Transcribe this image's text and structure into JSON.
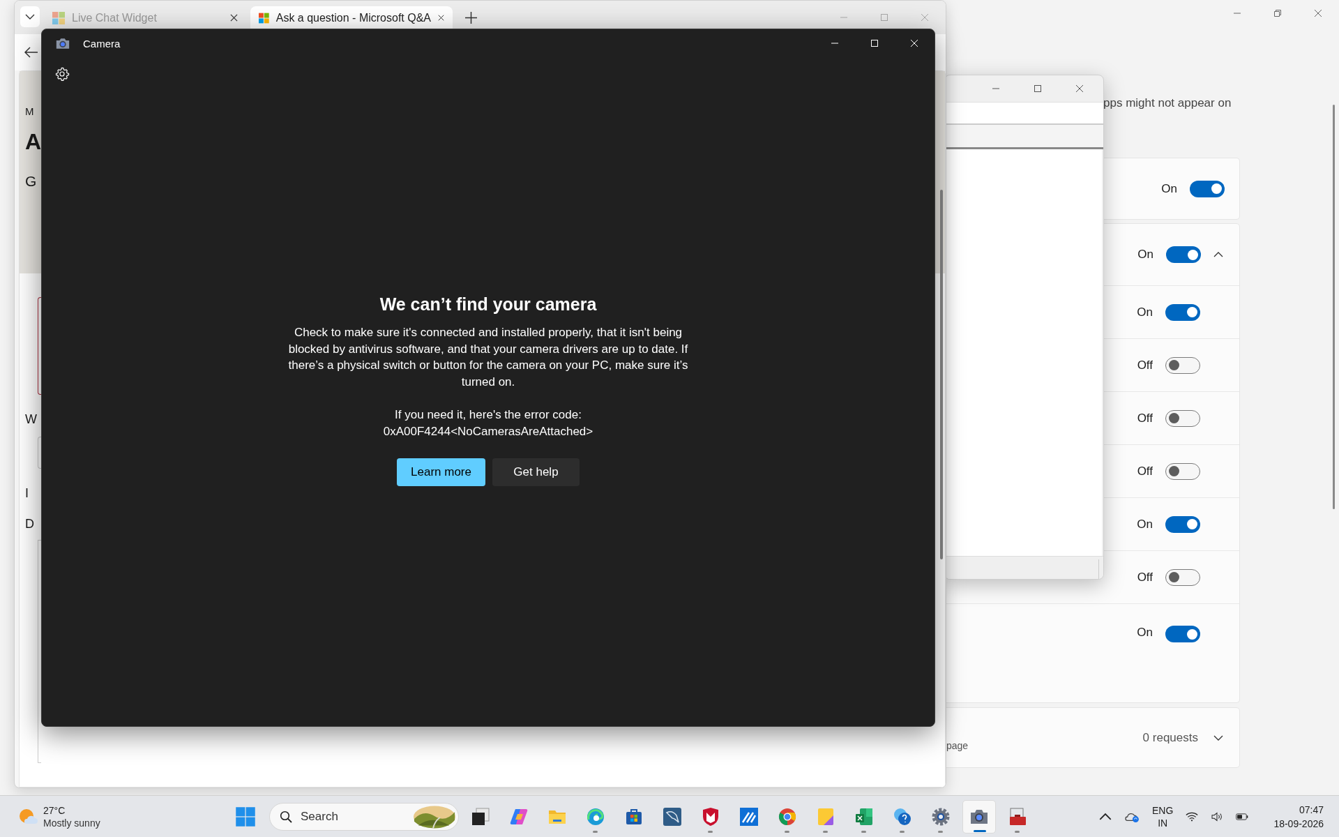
{
  "browser": {
    "tabs": [
      {
        "title": "Live Chat Widget",
        "selected": false
      },
      {
        "title": "Ask a question - Microsoft Q&A",
        "selected": true
      }
    ],
    "page_fragments": [
      {
        "text": "M",
        "kind": "small"
      },
      {
        "text": "A",
        "kind": "title"
      },
      {
        "text": "G",
        "kind": "lead"
      },
      {
        "text": "W",
        "kind": "label"
      },
      {
        "text": "I",
        "kind": "label"
      },
      {
        "text": "D",
        "kind": "label"
      }
    ]
  },
  "camera_window": {
    "title": "Camera",
    "heading": "We can’t find your camera",
    "message": "Check to make sure it's connected and installed properly, that it isn't being blocked by antivirus software, and that your camera drivers are up to date. If there’s a physical switch or button for the camera on your PC, make sure it’s turned on.",
    "error_intro": "If you need it, here's the error code:",
    "error_code": "0xA00F4244<NoCamerasAreAttached>",
    "buttons": [
      {
        "label": "Learn more",
        "kind": "primary"
      },
      {
        "label": "Get help",
        "kind": "secondary"
      }
    ]
  },
  "settings": {
    "description": "pps might not appear on",
    "toggles": [
      {
        "label": "On",
        "on": true,
        "kind": "card"
      },
      {
        "label": "On",
        "on": true,
        "kind": "expander"
      },
      {
        "label": "On",
        "on": true,
        "kind": "row"
      },
      {
        "label": "Off",
        "on": false,
        "kind": "row"
      },
      {
        "label": "Off",
        "on": false,
        "kind": "row"
      },
      {
        "label": "Off",
        "on": false,
        "kind": "row"
      },
      {
        "label": "On",
        "on": true,
        "kind": "row"
      },
      {
        "label": "Off",
        "on": false,
        "kind": "row"
      },
      {
        "label": "On",
        "on": true,
        "kind": "last"
      }
    ],
    "requests": {
      "caption": "page",
      "count": "0 requests"
    }
  },
  "taskbar": {
    "weather": {
      "temperature": "27°C",
      "condition": "Mostly sunny"
    },
    "search": {
      "placeholder": "Search"
    },
    "apps": [
      {
        "kind": "taskview",
        "running": false,
        "active": false
      },
      {
        "kind": "copilot",
        "running": false,
        "active": false
      },
      {
        "kind": "folder",
        "running": false,
        "active": false
      },
      {
        "kind": "edge",
        "running": true,
        "active": false
      },
      {
        "kind": "store",
        "running": false,
        "active": false
      },
      {
        "kind": "dolphin",
        "running": false,
        "active": false
      },
      {
        "kind": "shield",
        "running": true,
        "active": false
      },
      {
        "kind": "tile",
        "running": false,
        "active": false
      },
      {
        "kind": "chrome",
        "running": true,
        "active": false
      },
      {
        "kind": "notes",
        "running": true,
        "active": false
      },
      {
        "kind": "excel",
        "running": true,
        "active": false
      },
      {
        "kind": "help",
        "running": true,
        "active": false
      },
      {
        "kind": "settings",
        "running": true,
        "active": false
      },
      {
        "kind": "camera",
        "running": true,
        "active": true
      },
      {
        "kind": "toolbox",
        "running": true,
        "active": false
      }
    ],
    "language": [
      "ENG",
      "IN"
    ],
    "time": "07:47",
    "date": "18-09-2026"
  }
}
